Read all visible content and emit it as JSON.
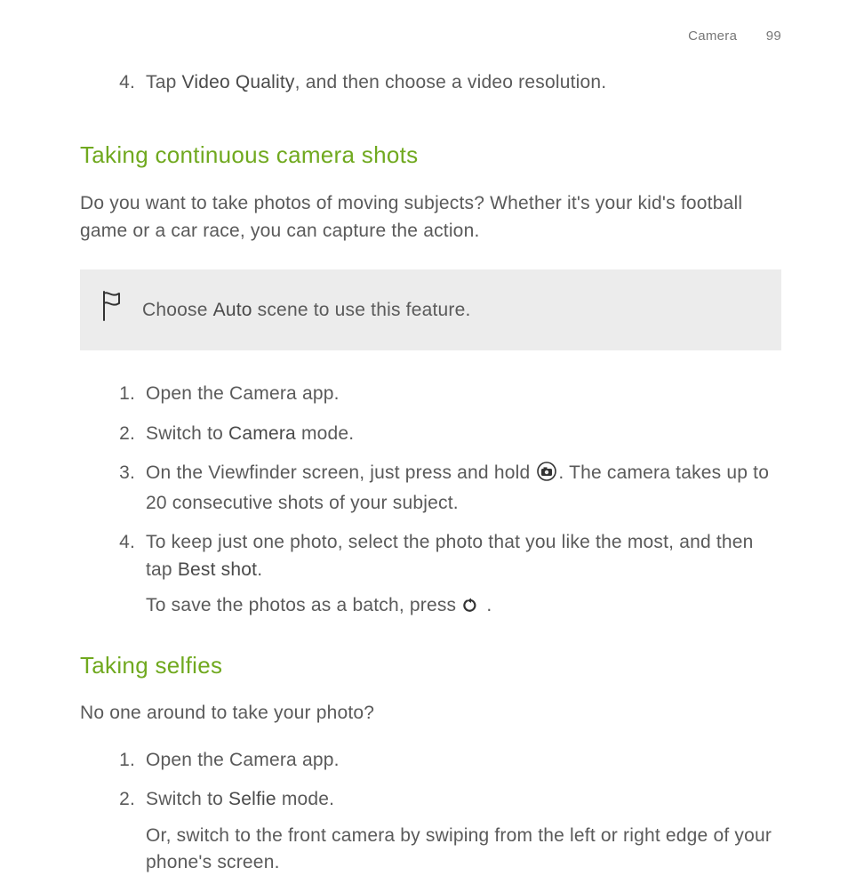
{
  "header": {
    "section": "Camera",
    "page": "99"
  },
  "lead_step": {
    "num": "4",
    "pre": "Tap ",
    "bold": "Video Quality",
    "post": ", and then choose a video resolution."
  },
  "s1": {
    "heading": "Taking continuous camera shots",
    "intro": "Do you want to take photos of moving subjects? Whether it's your kid's football game or a car race, you can capture the action.",
    "tip_pre": "Choose ",
    "tip_bold": "Auto",
    "tip_post": " scene to use this feature.",
    "steps": [
      {
        "num": "1",
        "text": "Open the Camera app."
      },
      {
        "num": "2",
        "pre": "Switch to ",
        "bold": "Camera",
        "post": " mode."
      },
      {
        "num": "3",
        "pre": "On the Viewfinder screen, just press and hold ",
        "post": ". The camera takes up to 20 consecutive shots of your subject."
      },
      {
        "num": "4",
        "pre": "To keep just one photo, select the photo that you like the most, and then tap ",
        "bold": "Best shot",
        "post": ".",
        "sub_pre": "To save the photos as a batch, press ",
        "sub_post": " ."
      }
    ]
  },
  "s2": {
    "heading": "Taking selfies",
    "intro": "No one around to take your photo?",
    "steps": [
      {
        "num": "1",
        "text": "Open the Camera app."
      },
      {
        "num": "2",
        "pre": "Switch to ",
        "bold": "Selfie",
        "post": " mode.",
        "sub": "Or, switch to the front camera by swiping from the left or right edge of your phone's screen."
      }
    ]
  }
}
